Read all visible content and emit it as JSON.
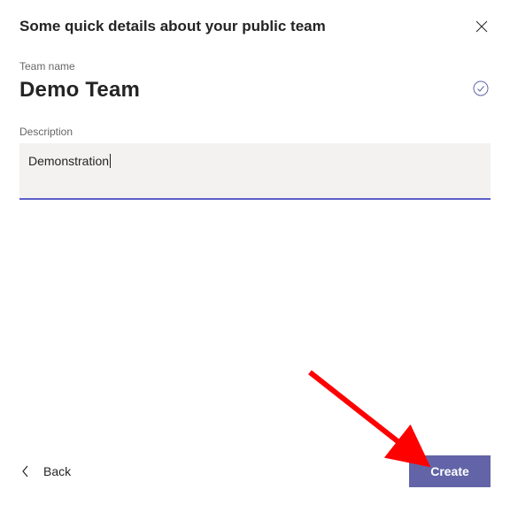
{
  "dialog": {
    "title": "Some quick details about your public team"
  },
  "fields": {
    "team_name_label": "Team name",
    "team_name_value": "Demo Team",
    "description_label": "Description",
    "description_value": "Demonstration"
  },
  "footer": {
    "back_label": "Back",
    "create_label": "Create"
  },
  "colors": {
    "primary": "#6264a7",
    "annotation": "#ff0000"
  }
}
